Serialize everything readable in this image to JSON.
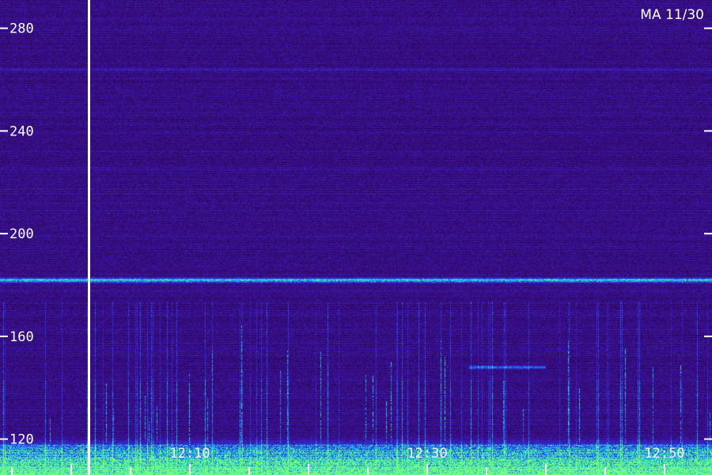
{
  "chart_data": {
    "type": "heatmap",
    "title": "MA 11/30",
    "xlabel": "",
    "ylabel": "",
    "y_ticks": [
      120,
      160,
      200,
      240,
      280
    ],
    "ylim": [
      106,
      291
    ],
    "x_ticks": [
      "12:10",
      "12:30",
      "12:50"
    ],
    "x_tick_minutes": [
      10,
      30,
      50
    ],
    "xlim_minutes": [
      -6,
      54
    ],
    "marker_minute": 1.5,
    "features": {
      "horizontal_band_y": 182,
      "faint_band_y": 264,
      "low_freq_band_y": 110,
      "short_band_y": 148,
      "short_band_minutes": [
        33.5,
        40
      ]
    },
    "colors": {
      "background": "#1a0530",
      "low": "#3a0a7a",
      "mid": "#2a3cf0",
      "high": "#20e0d0",
      "peak": "#40ff90"
    }
  }
}
